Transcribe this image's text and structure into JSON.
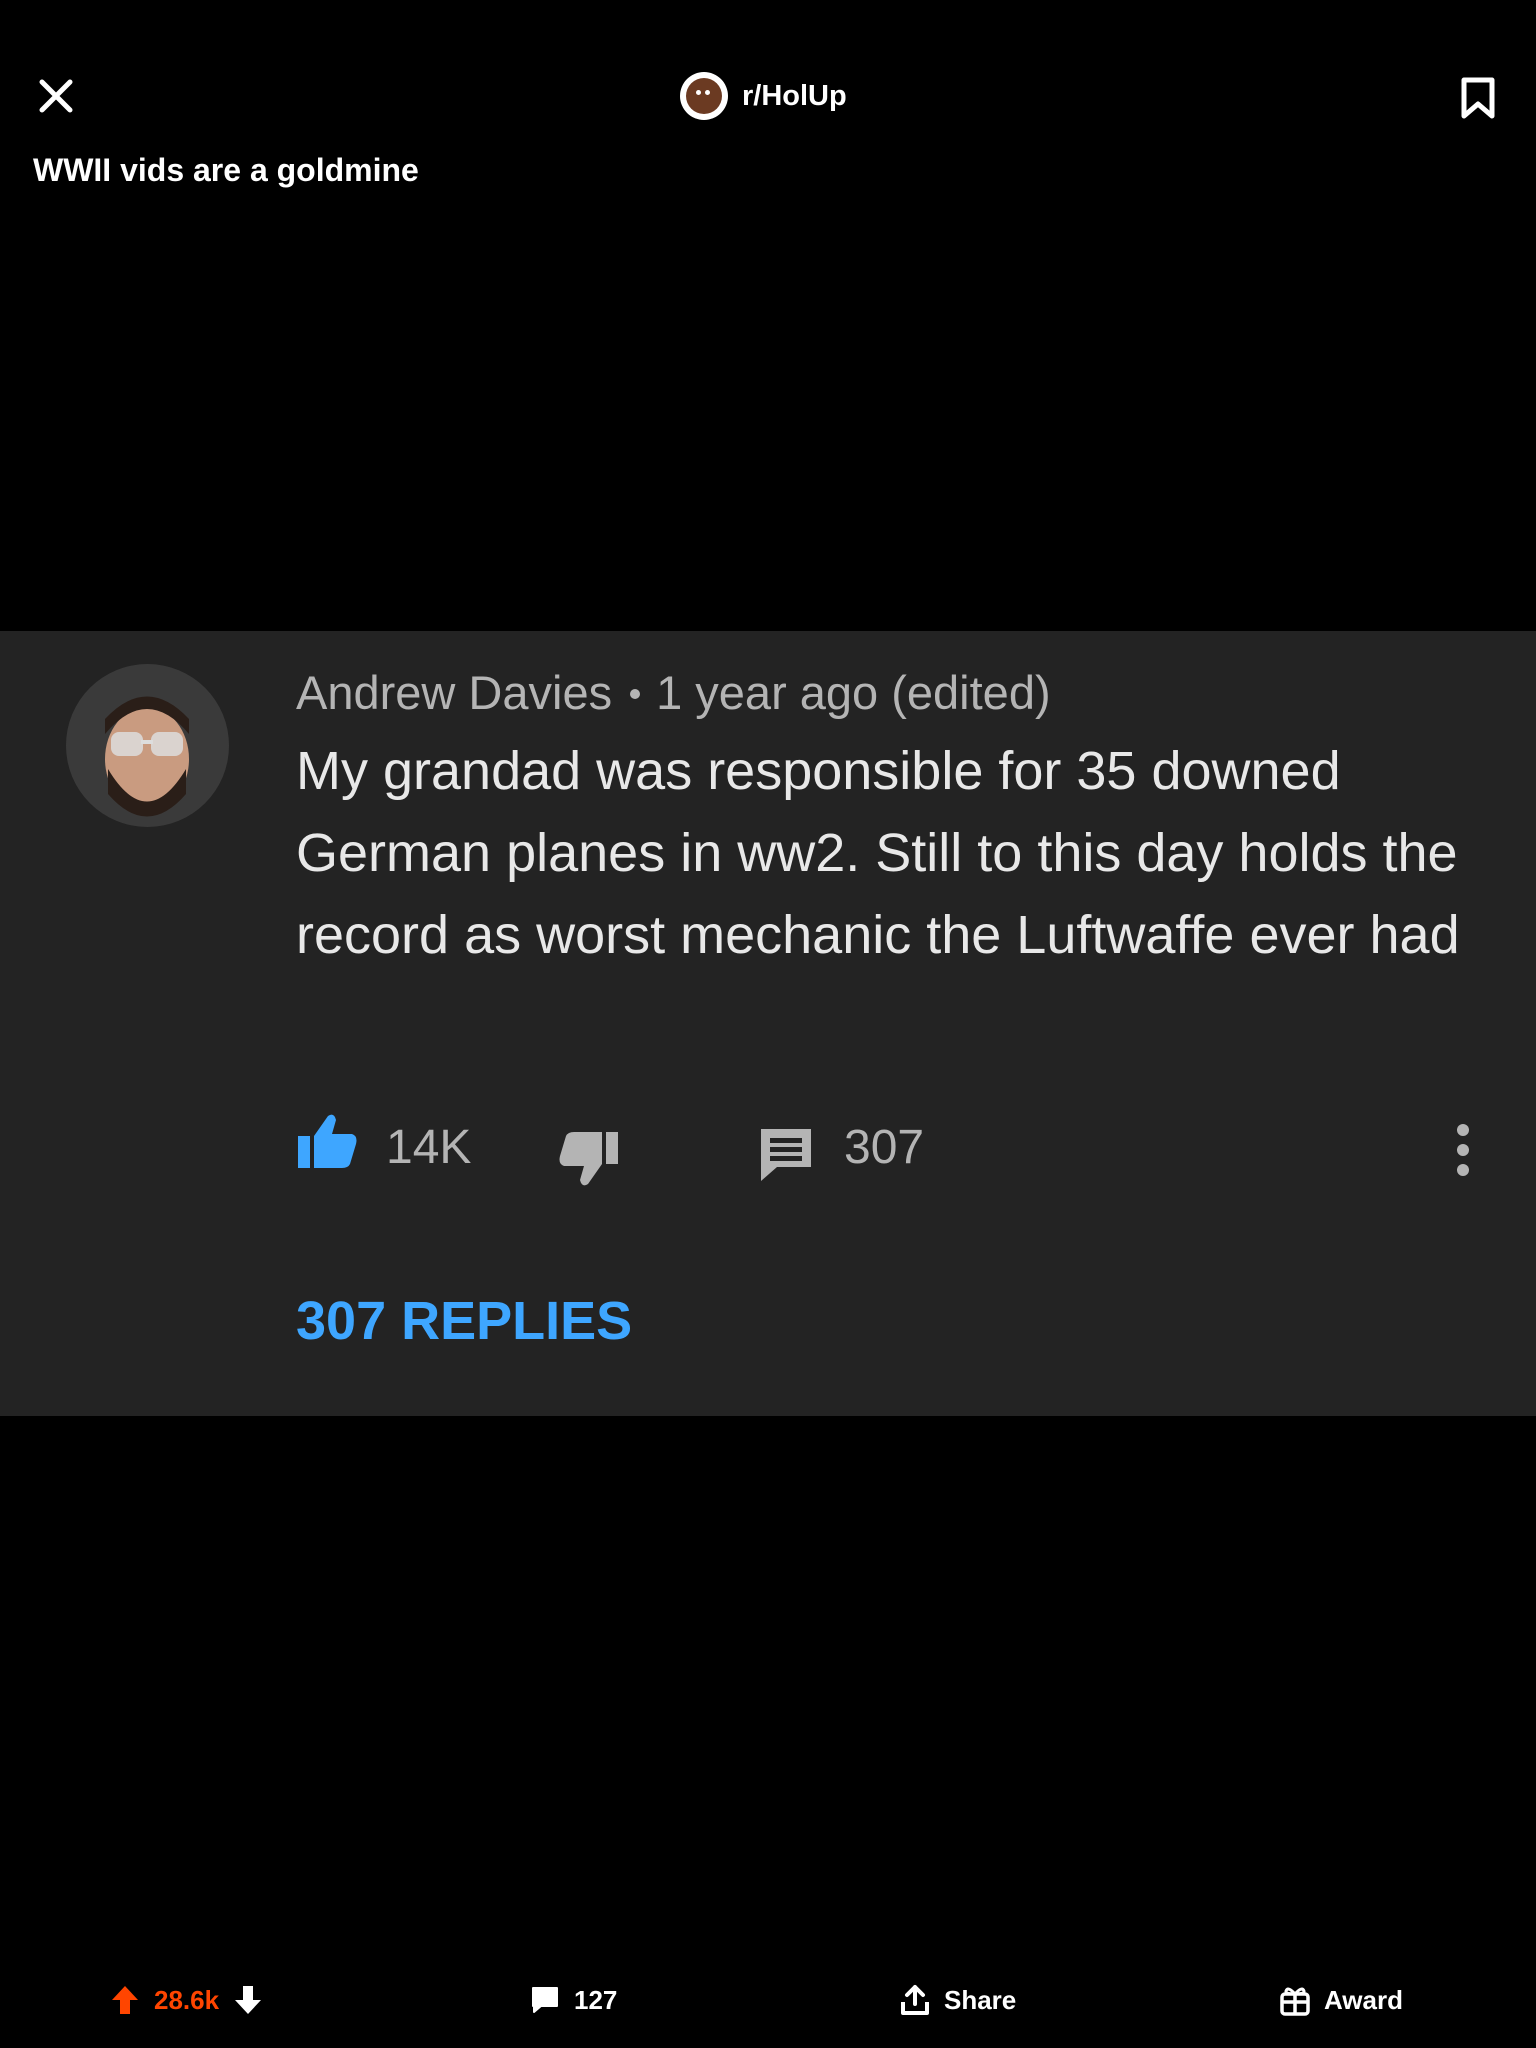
{
  "header": {
    "subreddit": "r/HolUp",
    "post_title": "WWII vids are a goldmine"
  },
  "comment": {
    "author": "Andrew Davies",
    "timestamp": "1 year ago (edited)",
    "text": "My grandad was responsible for  35 downed German planes in ww2. Still to this day holds the record as worst mechanic the Luftwaffe ever had",
    "likes": "14K",
    "reply_count": "307",
    "replies_label": "307 REPLIES",
    "like_color": "#3ea6ff",
    "replies_color": "#3ea6ff"
  },
  "bottom_bar": {
    "vote_count": "28.6k",
    "comment_count": "127",
    "share_label": "Share",
    "award_label": "Award",
    "upvote_color": "#ff4500"
  },
  "icons": [
    "close-icon",
    "bookmark-icon",
    "thumbs-up-icon",
    "thumbs-down-icon",
    "comment-icon",
    "more-vertical-icon",
    "upvote-icon",
    "downvote-icon",
    "share-icon",
    "gift-icon"
  ]
}
